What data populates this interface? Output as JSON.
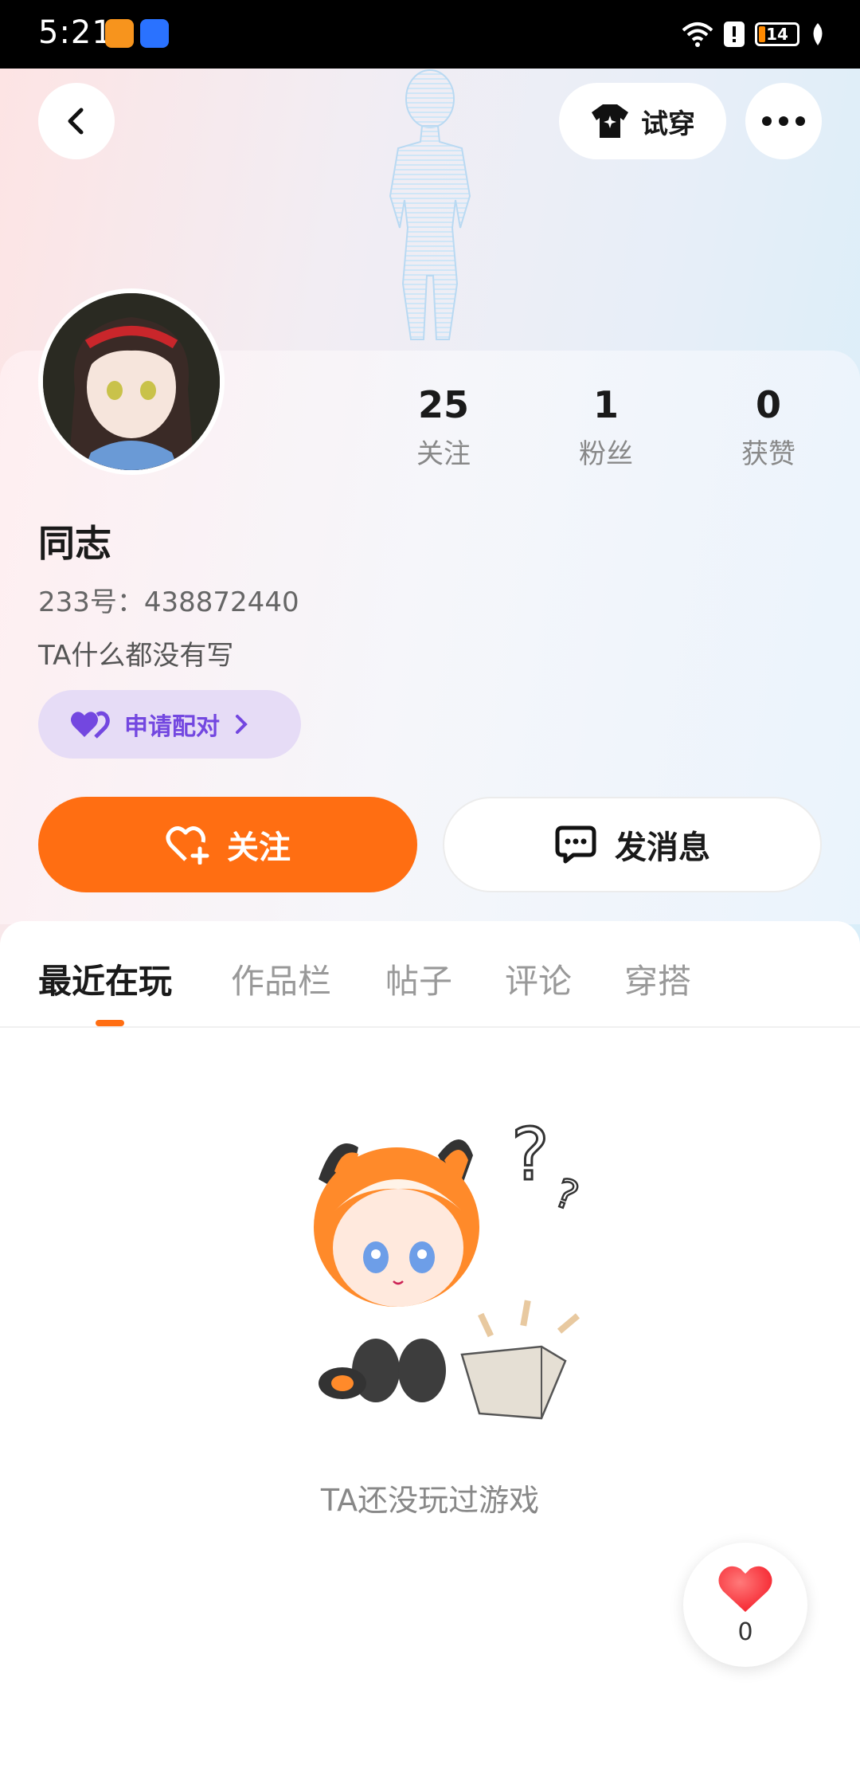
{
  "status_bar": {
    "time": "5:21",
    "battery": "14"
  },
  "header": {
    "tryon_label": "试穿"
  },
  "stats": [
    {
      "value": "25",
      "label": "关注"
    },
    {
      "value": "1",
      "label": "粉丝"
    },
    {
      "value": "0",
      "label": "获赞"
    }
  ],
  "profile": {
    "name": "同志",
    "uid": "233号：438872440",
    "bio": "TA什么都没有写",
    "pair_label": "申请配对"
  },
  "actions": {
    "follow_label": "关注",
    "message_label": "发消息"
  },
  "tabs": [
    "最近在玩",
    "作品栏",
    "帖子",
    "评论",
    "穿搭"
  ],
  "empty_state": {
    "text": "TA还没玩过游戏"
  },
  "like": {
    "count": "0"
  },
  "colors": {
    "accent": "#ff6e12",
    "pair_bg": "#e6dcf6",
    "pair_text": "#7347e0",
    "heart": "#ff3b4a"
  }
}
